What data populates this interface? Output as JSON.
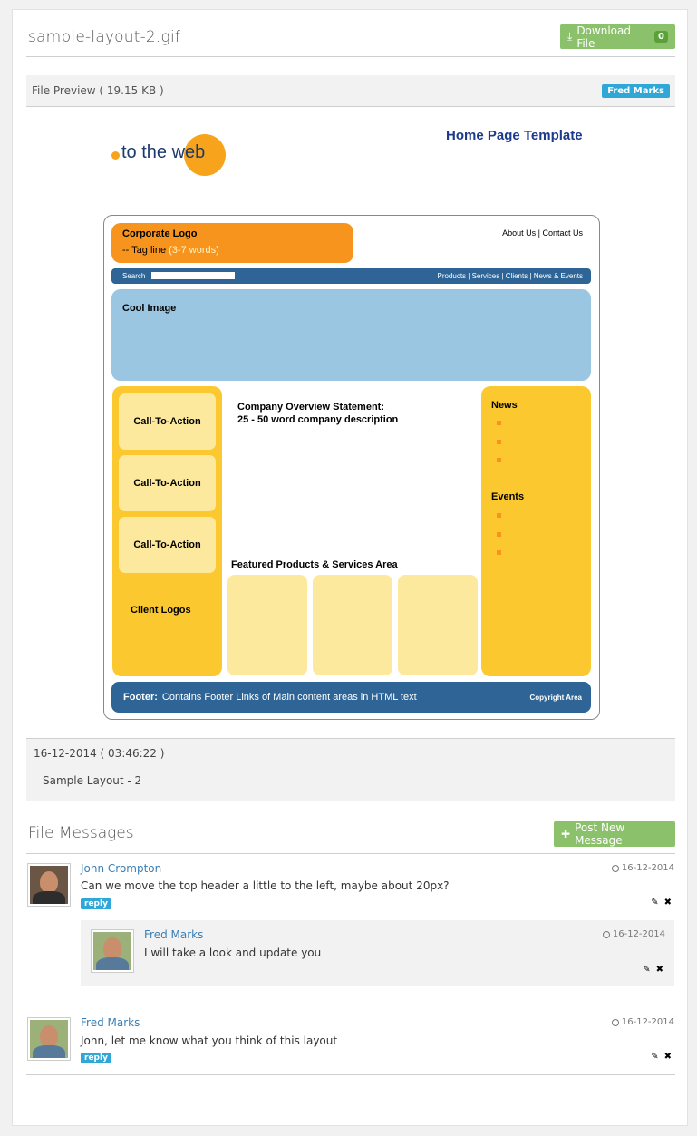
{
  "file": {
    "title": "sample-layout-2.gif",
    "download_label": "Download File",
    "download_count": "0",
    "preview_label": "File Preview ( 19.15 KB )",
    "owner_tag": "Fred Marks"
  },
  "preview": {
    "logo_text": "to the web",
    "page_title": "Home Page Template",
    "corp_logo": "Corporate Logo",
    "tagline_prefix": "-- Tag line",
    "tagline_suffix": "(3-7 words)",
    "top_links": "About Us  |  Contact Us",
    "search": "Search",
    "nav_links": "Products  |  Services | Clients | News & Events",
    "cool_image": "Cool Image",
    "cta": [
      "Call-To-Action",
      "Call-To-Action",
      "Call-To-Action"
    ],
    "client_logos": "Client Logos",
    "overview_line1": "Company Overview Statement:",
    "overview_line2": "25 - 50 word company description",
    "featured": "Featured Products & Services Area",
    "news": "News",
    "events": "Events",
    "footer_label": "Footer:",
    "footer_text": "Contains Footer Links of Main content areas in HTML text",
    "copyright": "Copyright Area"
  },
  "meta": {
    "datetime": "16-12-2014 ( 03:46:22 )",
    "note": "Sample Layout - 2"
  },
  "messages": {
    "header": "File Messages",
    "post_label": "Post New Message",
    "items": [
      {
        "author": "John Crompton",
        "text": "Can we move the top header a little to the left, maybe about 20px?",
        "date": "16-12-2014",
        "reply": "reply"
      },
      {
        "author": "Fred Marks",
        "text": "I will take a look and update you",
        "date": "16-12-2014"
      },
      {
        "author": "Fred Marks",
        "text": "John, let me know what you think of this layout",
        "date": "16-12-2014",
        "reply": "reply"
      }
    ]
  },
  "colors": {
    "accent_green": "#8bc16b",
    "tag_blue": "#2fa8d8",
    "link_blue": "#3a7fb5"
  },
  "icons": {
    "download": "download-icon",
    "plus": "plus-icon",
    "clock": "clock-icon",
    "edit": "pencil-icon",
    "delete": "close-icon"
  }
}
